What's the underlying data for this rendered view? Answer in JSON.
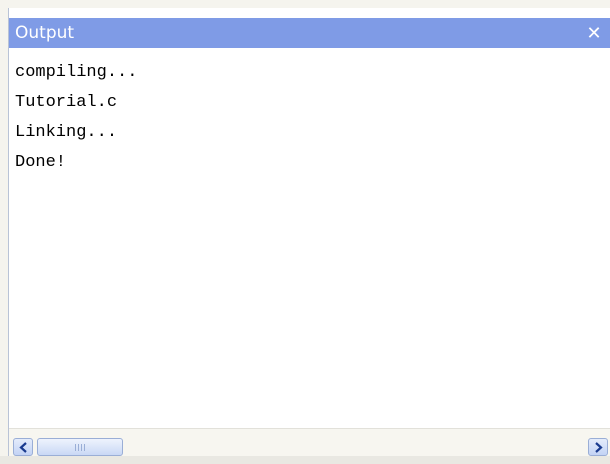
{
  "window": {
    "title": "Output",
    "close_symbol": "✕"
  },
  "output": {
    "lines": [
      "compiling...",
      "Tutorial.c",
      "Linking...",
      "Done!"
    ]
  },
  "icons": {
    "close": "close-icon",
    "scroll_left": "chevron-left-icon",
    "scroll_right": "chevron-right-icon"
  },
  "colors": {
    "titlebar": "#7f9be6",
    "title_text": "#ffffff",
    "background": "#ffffff",
    "scrollbar_track": "#f7f6f0",
    "scroll_button": "#c3d3f5"
  }
}
